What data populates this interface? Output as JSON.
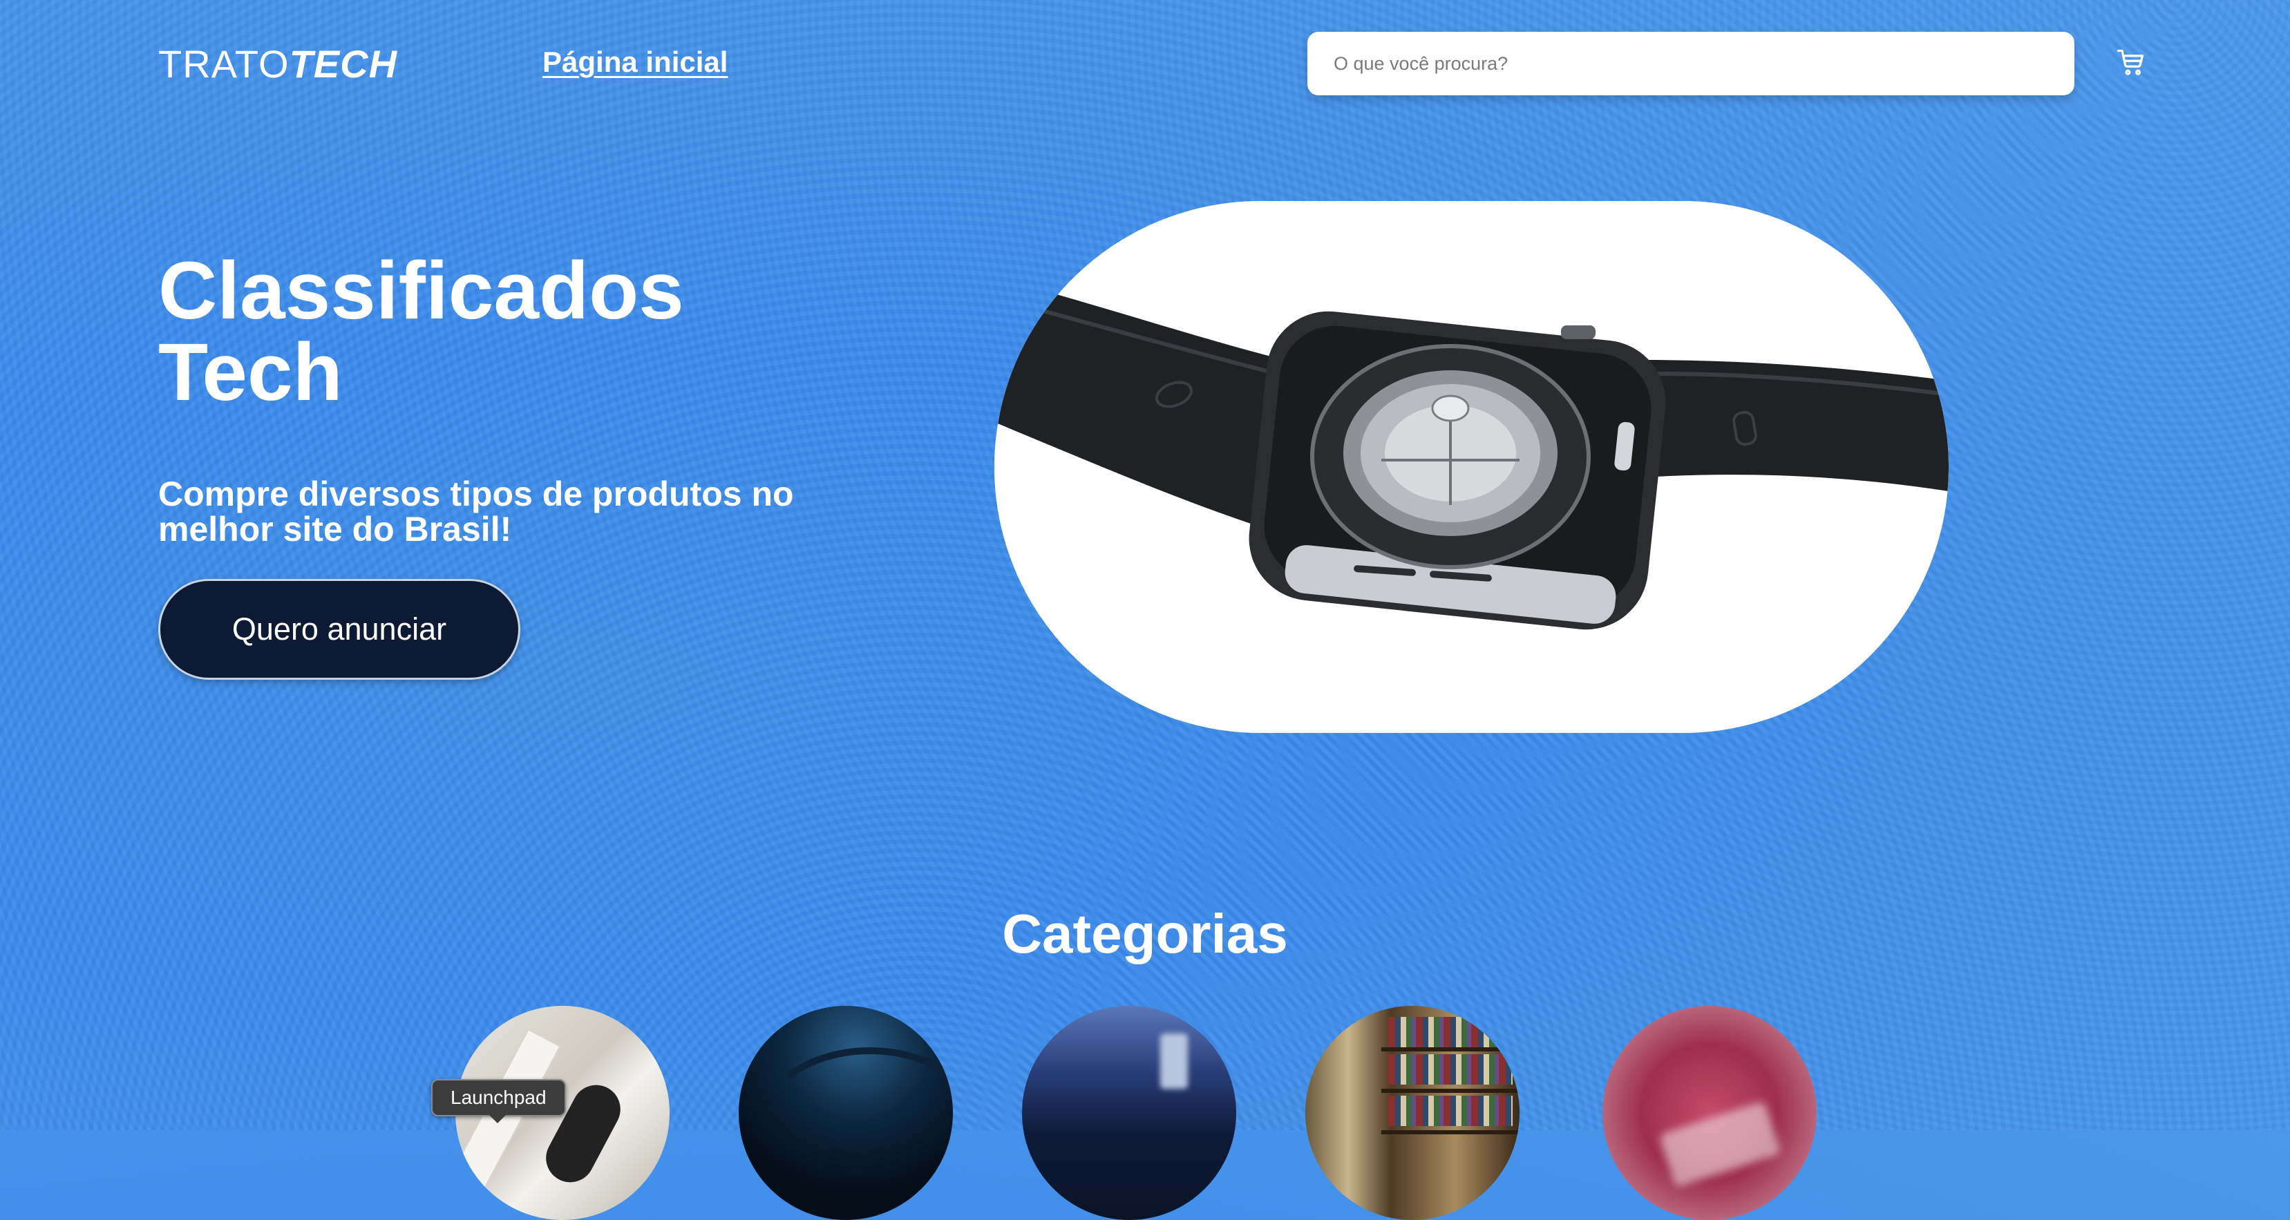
{
  "header": {
    "logo_light": "TRATO",
    "logo_bold": "TECH",
    "nav_home": "Página inicial",
    "search_placeholder": "O que você procura?",
    "cart_icon": "cart-icon"
  },
  "hero": {
    "title_line1": "Classificados",
    "title_line2": "Tech",
    "subtitle": "Compre diversos tipos de produtos no melhor site do Brasil!",
    "cta_label": "Quero anunciar",
    "image_subject": "smartwatch"
  },
  "categories": {
    "title": "Categorias",
    "items": [
      {
        "image": "category-image-1"
      },
      {
        "image": "category-image-2"
      },
      {
        "image": "category-image-3"
      },
      {
        "image": "category-image-4"
      },
      {
        "image": "category-image-5"
      }
    ]
  },
  "dock": {
    "tooltip": "Launchpad"
  },
  "colors": {
    "background": "#3a8aea",
    "cta_background": "#0d1a33",
    "text": "#ffffff"
  }
}
